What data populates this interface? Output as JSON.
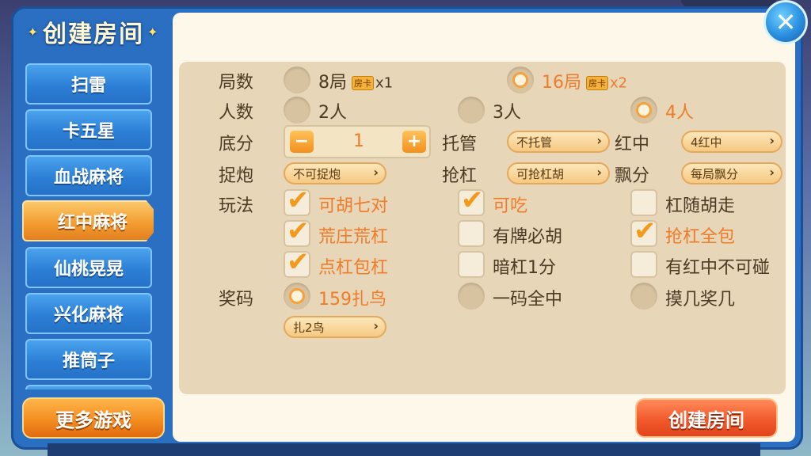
{
  "title": "创建房间",
  "tabs": [
    "扫雷",
    "卡五星",
    "血战麻将",
    "红中麻将",
    "仙桃晃晃",
    "兴化麻将",
    "推筒子"
  ],
  "active_tab": "红中麻将",
  "more_games": "更多游戏",
  "create_room": "创建房间",
  "close_icon": "✕",
  "rows": {
    "rounds": {
      "label": "局数",
      "options": [
        {
          "text": "8局",
          "badge": "房卡",
          "mult": "x1",
          "selected": false
        },
        {
          "text": "16局",
          "badge": "房卡",
          "mult": "x2",
          "selected": true
        }
      ]
    },
    "players": {
      "label": "人数",
      "options": [
        {
          "text": "2人",
          "selected": false
        },
        {
          "text": "3人",
          "selected": false
        },
        {
          "text": "4人",
          "selected": true
        }
      ]
    },
    "base_score": {
      "label": "底分",
      "minus": "−",
      "value": "1",
      "plus": "+"
    },
    "auto_play": {
      "label": "托管",
      "value": "不托管"
    },
    "red_zhong": {
      "label": "红中",
      "value": "4红中"
    },
    "catch_gun": {
      "label": "捉炮",
      "value": "不可捉炮"
    },
    "rob_kong": {
      "label": "抢杠",
      "value": "可抢杠胡"
    },
    "piao": {
      "label": "飘分",
      "value": "每局飘分"
    },
    "play": {
      "label": "玩法",
      "options": [
        {
          "text": "可胡七对",
          "checked": true
        },
        {
          "text": "可吃",
          "checked": true
        },
        {
          "text": "杠随胡走",
          "checked": false
        },
        {
          "text": "荒庄荒杠",
          "checked": true
        },
        {
          "text": "有牌必胡",
          "checked": false
        },
        {
          "text": "抢杠全包",
          "checked": true
        },
        {
          "text": "点杠包杠",
          "checked": true
        },
        {
          "text": "暗杠1分",
          "checked": false
        },
        {
          "text": "有红中不可碰",
          "checked": false
        }
      ]
    },
    "prize_code": {
      "label": "奖码",
      "options": [
        {
          "text": "159扎鸟",
          "selected": true
        },
        {
          "text": "一码全中",
          "selected": false
        },
        {
          "text": "摸几奖几",
          "selected": false
        }
      ],
      "dropdown": "扎2鸟"
    }
  },
  "colors": {
    "accent": "#f07c2a",
    "panel_blue": "#2b6fc2",
    "create_red": "#f25a2c"
  }
}
